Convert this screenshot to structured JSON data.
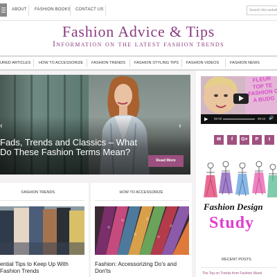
{
  "topbar": {
    "links": [
      "ABOUT",
      "FASHION BOOKS",
      "CONTACT US"
    ],
    "search_placeholder": "Search this website"
  },
  "header": {
    "title": "Fashion Advice & Tips",
    "tagline": "Information on the latest fashion trends"
  },
  "nav": {
    "items": [
      "URED ARTICLES",
      "HOW TO ACCESSORIZE",
      "FASHION TRENDS",
      "FASHION STYLING TIPS",
      "FASHION VIDEOS",
      "FASHION NEWS"
    ]
  },
  "slider": {
    "caption": "Fads, Trends and Classics – What Do These Fashion Terms Mean?",
    "read_more": "Read More",
    "prev_icon": "‹",
    "next_icon": "›"
  },
  "sections": [
    {
      "heading": "FASHION TRENDS",
      "post_title": "ential Tips to Keep Up With Fashion Trends"
    },
    {
      "heading": "HOW TO ACCESSORIZE",
      "post_title": "Fashion: Accessorizing Do's and Don'ts"
    }
  ],
  "sidebar": {
    "video": {
      "overlay_text": "FLEUR TOP TE FASHION C A BUDG",
      "time_current": "00:00",
      "time_total": "06:44"
    },
    "social_icons": [
      {
        "name": "email-icon",
        "glyph": "✉"
      },
      {
        "name": "facebook-icon",
        "glyph": "f"
      },
      {
        "name": "google-plus-icon",
        "glyph": "G+"
      },
      {
        "name": "pinterest-icon",
        "glyph": "P"
      },
      {
        "name": "twitter-icon",
        "glyph": "t"
      }
    ],
    "art_text_1": "Fashion Design",
    "art_text_2": "Study",
    "recent_heading": "RECENT POSTS",
    "recent_item": "The Top on Trends from Fashion Week"
  },
  "colors": {
    "brand_purple": "#8a3b80",
    "button_plum": "#9b4f7e"
  }
}
